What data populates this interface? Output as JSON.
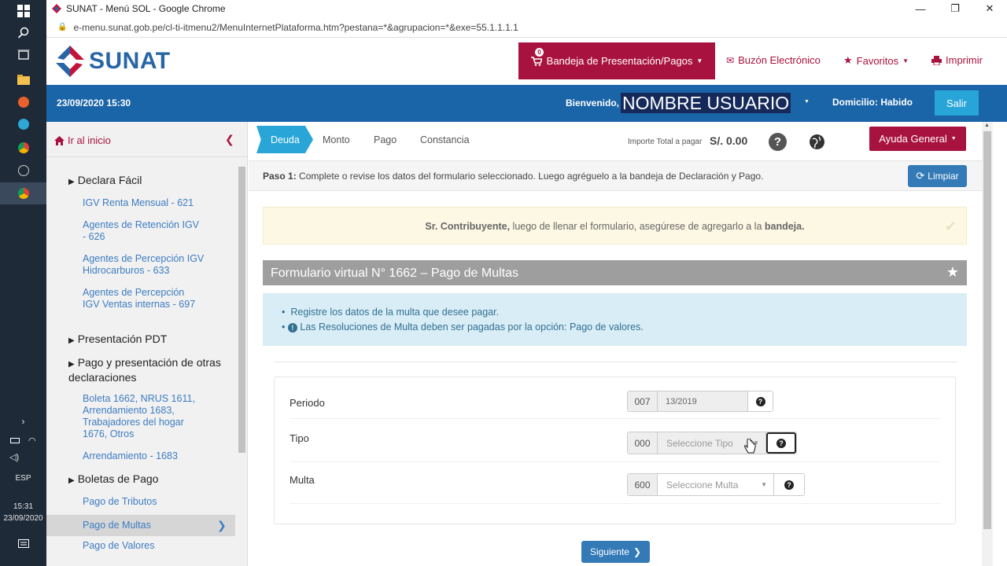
{
  "window": {
    "title": "SUNAT - Menú SOL - Google Chrome",
    "url": "e-menu.sunat.gob.pe/cl-ti-itmenu2/MenuInternetPlataforma.htm?pestana=*&agrupacion=*&exe=55.1.1.1.1"
  },
  "taskbar": {
    "language": "ESP",
    "time": "15:31",
    "date": "23/09/2020"
  },
  "header": {
    "logo_text": "SUNAT",
    "bandeja_label": "Bandeja de Presentación/Pagos",
    "bandeja_count": "0",
    "buzon_label": "Buzón Electrónico",
    "favoritos_label": "Favoritos",
    "imprimir_label": "Imprimir"
  },
  "userbar": {
    "datetime": "23/09/2020 15:30",
    "welcome": "Bienvenido,",
    "username": "NOMBRE USUARIO",
    "domicilio": "Domicilio: Habido",
    "salir": "Salir"
  },
  "sidebar": {
    "home": "Ir al inicio",
    "items": [
      {
        "type": "section",
        "label": "Declara Fácil"
      },
      {
        "type": "link",
        "label": "IGV Renta Mensual - 621"
      },
      {
        "type": "link",
        "label": "Agentes de Retención IGV - 626"
      },
      {
        "type": "link",
        "label": "Agentes de Percepción IGV Hidrocarburos - 633"
      },
      {
        "type": "link",
        "label": "Agentes de Percepción IGV Ventas internas - 697"
      },
      {
        "type": "section",
        "label": "Presentación PDT"
      },
      {
        "type": "section",
        "label": "Pago y presentación de otras declaraciones"
      },
      {
        "type": "link",
        "label": "Boleta 1662, NRUS 1611, Arrendamiento 1683, Trabajadores del hogar 1676, Otros"
      },
      {
        "type": "link",
        "label": "Arrendamiento - 1683"
      },
      {
        "type": "section",
        "label": "Boletas de Pago"
      },
      {
        "type": "link",
        "label": "Pago de Tributos"
      },
      {
        "type": "link",
        "label": "Pago de Multas",
        "active": true
      },
      {
        "type": "link",
        "label": "Pago de Valores"
      }
    ]
  },
  "steps": [
    "Deuda",
    "Monto",
    "Pago",
    "Constancia"
  ],
  "importe": {
    "label": "Importe Total a pagar",
    "value": "S/. 0.00"
  },
  "ayuda_label": "Ayuda General",
  "paso": {
    "prefix": "Paso 1:",
    "text": "Complete o revise los datos del formulario seleccionado. Luego agréguelo a la bandeja de Declaración y Pago.",
    "limpiar": "Limpiar"
  },
  "notice": {
    "bold1": "Sr. Contribuyente,",
    "text": " luego de llenar el formulario, asegúrese de agregarlo a la ",
    "bold2": "bandeja."
  },
  "form": {
    "title": "Formulario virtual N° 1662 – Pago de Multas",
    "info": [
      "Registre los datos de la multa que desee pagar.",
      "Las Resoluciones de Multa deben ser pagadas por la opción: Pago de valores."
    ],
    "fields": {
      "periodo": {
        "label": "Periodo",
        "code": "007",
        "value": "13/2019"
      },
      "tipo": {
        "label": "Tipo",
        "code": "000",
        "placeholder": "Seleccione Tipo"
      },
      "multa": {
        "label": "Multa",
        "code": "600",
        "placeholder": "Seleccione Multa"
      }
    },
    "siguiente": "Siguiente"
  },
  "colors": {
    "brand_blue": "#1a64a8",
    "brand_red": "#a8123f",
    "step_active": "#29a6d7",
    "button_blue": "#337ab7"
  }
}
